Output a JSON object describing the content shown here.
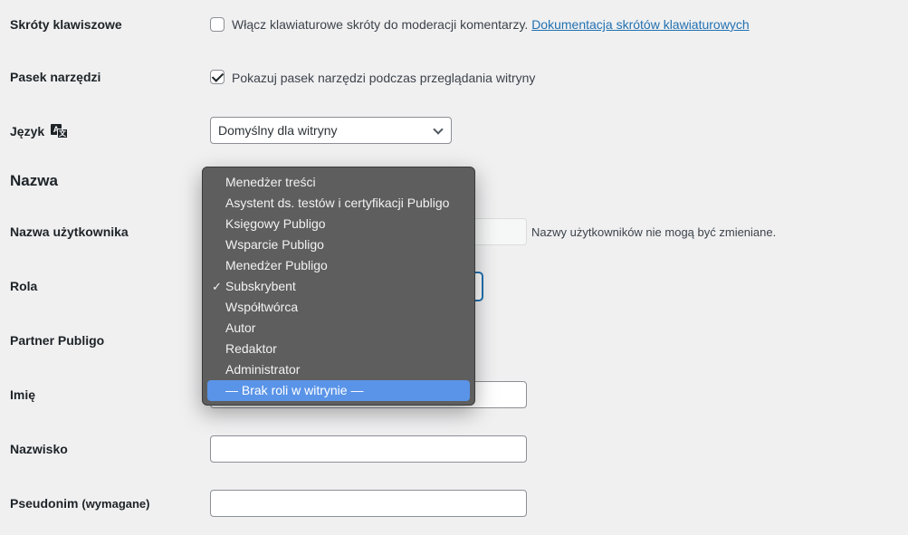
{
  "rows": {
    "shortcuts": {
      "label": "Skróty klawiszowe",
      "checkbox_text": "Włącz klawiaturowe skróty do moderacji komentarzy.",
      "link_text": "Dokumentacja skrótów klawiaturowych",
      "checked": false
    },
    "toolbar": {
      "label": "Pasek narzędzi",
      "checkbox_text": "Pokazuj pasek narzędzi podczas przeglądania witryny",
      "checked": true
    },
    "language": {
      "label": "Język",
      "value": "Domyślny dla witryny"
    },
    "name_section": "Nazwa",
    "username": {
      "label": "Nazwa użytkownika",
      "hint": "Nazwy użytkowników nie mogą być zmieniane."
    },
    "role": {
      "label": "Rola"
    },
    "partner": {
      "label": "Partner Publigo"
    },
    "first_name": {
      "label": "Imię"
    },
    "last_name": {
      "label": "Nazwisko"
    },
    "nickname": {
      "label": "Pseudonim",
      "required": "(wymagane)"
    }
  },
  "role_dropdown": {
    "options": [
      "Menedżer treści",
      "Asystent ds. testów i certyfikacji Publigo",
      "Księgowy Publigo",
      "Wsparcie Publigo",
      "Menedżer Publigo",
      "Subskrybent",
      "Współtwórca",
      "Autor",
      "Redaktor",
      "Administrator",
      "— Brak roli w witrynie —"
    ],
    "selected": "Subskrybent",
    "highlighted": "— Brak roli w witrynie —"
  },
  "icons": {
    "language": "translation-icon"
  },
  "colors": {
    "link": "#2271b1",
    "highlight": "#5a94e8",
    "menu_bg": "#5e5e5e"
  }
}
